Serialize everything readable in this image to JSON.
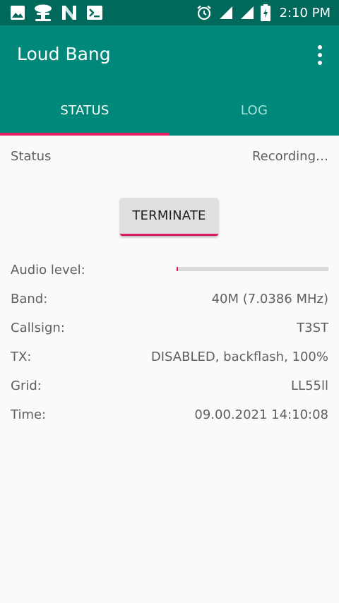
{
  "status_bar": {
    "time": "2:10 PM",
    "icons": [
      "image-icon",
      "mushroom-cloud-icon",
      "n-logo-icon",
      "terminal-icon",
      "alarm-icon",
      "signal-icon",
      "signal-icon",
      "battery-charging-icon"
    ]
  },
  "app": {
    "title": "Loud Bang",
    "menu_icon": "more-vert-icon"
  },
  "tabs": [
    {
      "label": "STATUS",
      "selected": true
    },
    {
      "label": "LOG",
      "selected": false
    }
  ],
  "status": {
    "label": "Status",
    "value": "Recording…"
  },
  "terminate_button": {
    "label": "TERMINATE"
  },
  "audio_level": {
    "label": "Audio level:",
    "fraction": 0.005
  },
  "fields": [
    {
      "label": "Band:",
      "value": "40M (7.0386 MHz)"
    },
    {
      "label": "Callsign:",
      "value": "T3ST"
    },
    {
      "label": "TX:",
      "value": "DISABLED, backflash, 100%"
    },
    {
      "label": "Grid:",
      "value": "LL55ll"
    },
    {
      "label": "Time:",
      "value": "09.00.2021 14:10:08"
    }
  ],
  "colors": {
    "status_bar": "#00695c",
    "app_bar": "#00897b",
    "accent": "#e91e63",
    "tab_inactive": "#a7e1da",
    "background": "#fafafa"
  }
}
